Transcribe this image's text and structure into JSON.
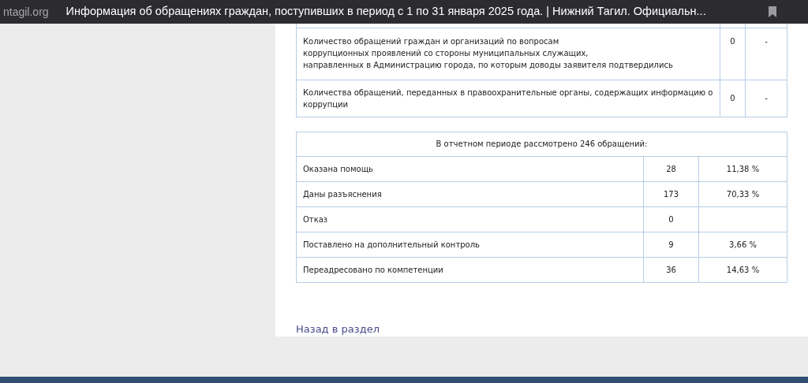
{
  "browser_bar": {
    "domain": "ntagil.org",
    "title": "Информация об обращениях граждан, поступивших в период с 1 по 31 января 2025 года. | Нижний Тагил. Официальн..."
  },
  "corruption_table": {
    "rows": [
      {
        "label": "Количество обращений граждан и организаций по вопросам\nкоррупционных проявлений со стороны муниципальных служащих,\nнаправленных в Администрацию города, по которым доводы заявителя подтвердились",
        "count": "0",
        "share": "-"
      },
      {
        "label": "Количества обращений, переданных в правоохранительные органы, содержащих информацию о коррупции",
        "count": "0",
        "share": "-"
      }
    ]
  },
  "summary_table": {
    "caption": "В отчетном периоде рассмотрено 246 обращений:",
    "rows": [
      {
        "label": "Оказана помощь",
        "count": "28",
        "share": "11,38 %"
      },
      {
        "label": "Даны разъяснения",
        "count": "173",
        "share": "70,33 %"
      },
      {
        "label": "Отказ",
        "count": "0"
      },
      {
        "label": "Поставлено на дополнительный контроль",
        "count": "9",
        "share": "3,66 %"
      },
      {
        "label": "Переадресовано по компетенции",
        "count": "36",
        "share": "14,63 %"
      }
    ]
  },
  "back_link": "Назад в раздел"
}
